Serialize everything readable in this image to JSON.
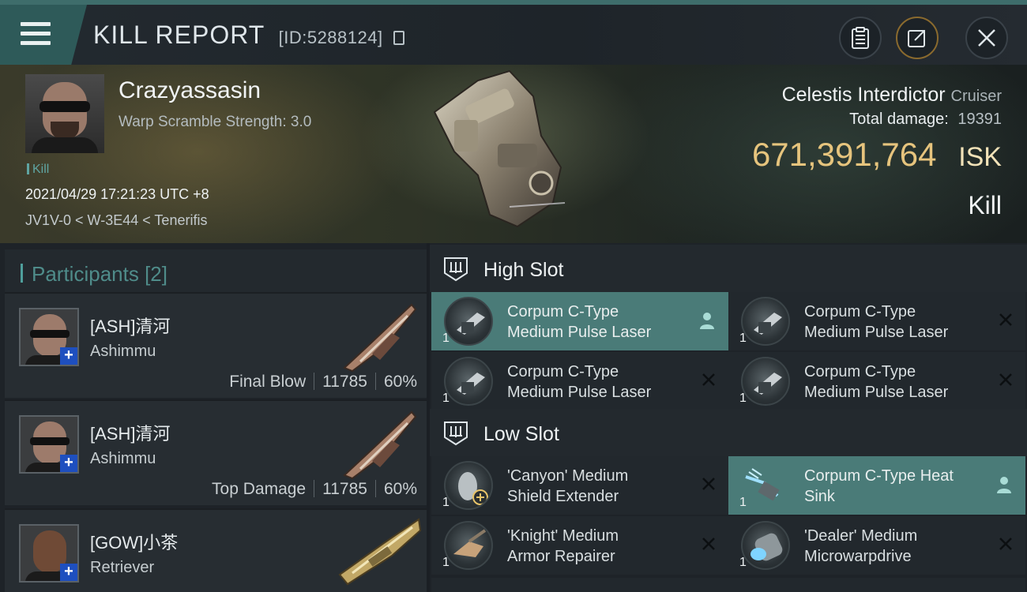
{
  "header": {
    "title": "KILL REPORT",
    "report_id": "[ID:5288124]",
    "menu_icon": "hamburger-menu-icon",
    "buttons": {
      "clipboard_icon": "clipboard-icon",
      "share_icon": "share-export-icon",
      "close_icon": "close-icon"
    }
  },
  "victim": {
    "name": "Crazyassasin",
    "subtitle": "Warp Scramble Strength: 3.0",
    "tag": "Kill",
    "datetime": "2021/04/29 17:21:23 UTC +8",
    "location": "JV1V-0 < W-3E44 < Tenerifis"
  },
  "ship": {
    "name": "Celestis Interdictor",
    "class": "Cruiser",
    "total_damage_label": "Total damage:",
    "total_damage": "19391",
    "isk_value": "671,391,764",
    "isk_unit": "ISK",
    "result": "Kill"
  },
  "participants": {
    "label": "Participants [2]",
    "rows": [
      {
        "name": "[ASH]清河",
        "ship": "Ashimmu",
        "role": "Final Blow",
        "damage": "11785",
        "percent": "60%"
      },
      {
        "name": "[ASH]清河",
        "ship": "Ashimmu",
        "role": "Top Damage",
        "damage": "11785",
        "percent": "60%"
      },
      {
        "name": "[GOW]小茶",
        "ship": "Retriever"
      }
    ]
  },
  "fittings": {
    "high_slot": {
      "label": "High Slot",
      "modules": [
        {
          "line1": "Corpum C-Type",
          "line2": "Medium Pulse Laser",
          "qty": "1",
          "state": "dropped"
        },
        {
          "line1": "Corpum C-Type",
          "line2": "Medium Pulse Laser",
          "qty": "1",
          "state": "destroyed"
        },
        {
          "line1": "Corpum C-Type",
          "line2": "Medium Pulse Laser",
          "qty": "1",
          "state": "destroyed"
        },
        {
          "line1": "Corpum C-Type",
          "line2": "Medium Pulse Laser",
          "qty": "1",
          "state": "destroyed"
        }
      ]
    },
    "low_slot": {
      "label": "Low Slot",
      "modules": [
        {
          "line1": "'Canyon' Medium",
          "line2": "Shield Extender",
          "qty": "1",
          "state": "destroyed"
        },
        {
          "line1": "Corpum C-Type Heat",
          "line2": "Sink",
          "qty": "1",
          "state": "dropped"
        },
        {
          "line1": "'Knight' Medium",
          "line2": "Armor Repairer",
          "qty": "1",
          "state": "destroyed"
        },
        {
          "line1": "'Dealer' Medium",
          "line2": "Microwarpdrive",
          "qty": "1",
          "state": "destroyed"
        }
      ]
    }
  },
  "colors": {
    "accent_teal": "#4a7b78",
    "isk_gold": "#e6c47d",
    "participants_label": "#4f8c8a",
    "plus_badge": "#1e4fbf"
  }
}
